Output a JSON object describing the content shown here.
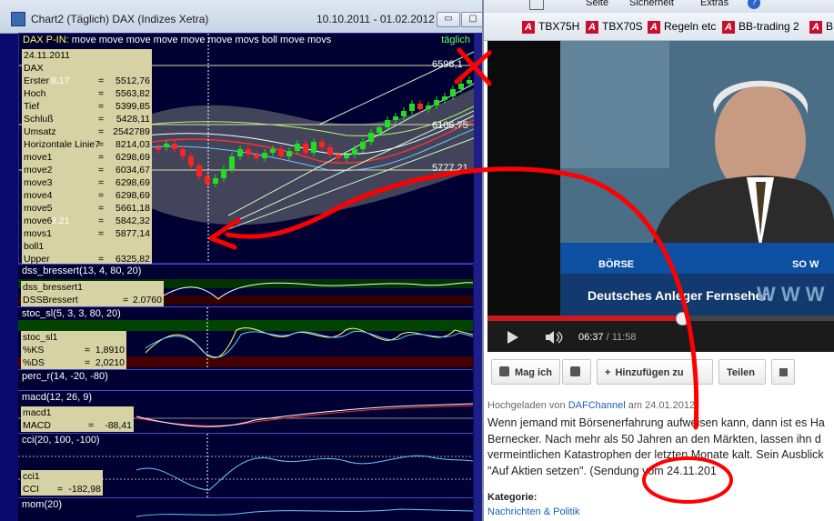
{
  "chart_window": {
    "title": "Chart2 (Täglich)  DAX (Indizes Xetra)",
    "date_range": "10.10.2011 - 01.02.2012",
    "minimize_label": "▭",
    "maximize_label": "▢"
  },
  "main_panel": {
    "headline_prefix": "DAX P-IN:",
    "headline_indicators": "move move move move move move movs boll move movs",
    "period_label": "täglich",
    "legend": [
      {
        "name": "24.11.2011",
        "value": ""
      },
      {
        "name": "DAX",
        "value": ""
      },
      {
        "name": "Erster",
        "value": "5512,76"
      },
      {
        "name": "Hoch",
        "value": "5563,82"
      },
      {
        "name": "Tief",
        "value": "5399,85"
      },
      {
        "name": "Schluß",
        "value": "5428,11"
      },
      {
        "name": "Umsatz",
        "value": "2542789"
      },
      {
        "name": "Horizontale Linie7",
        "value": "8214,03"
      },
      {
        "name": "move1",
        "value": "6298,69"
      },
      {
        "name": "move2",
        "value": "6034,67"
      },
      {
        "name": "move3",
        "value": "6298,69"
      },
      {
        "name": "move4",
        "value": "6298,69"
      },
      {
        "name": "move5",
        "value": "5661,18"
      },
      {
        "name": "move6",
        "value": "5842,32"
      },
      {
        "name": "movs1",
        "value": "5877,14"
      },
      {
        "name": "boll1",
        "value": ""
      },
      {
        "name": "Upper",
        "value": "6325,82"
      }
    ],
    "price_labels": [
      "6598,1",
      "6106,75",
      "5777,21"
    ],
    "side_labels": [
      "8,17",
      "3,21"
    ]
  },
  "indicators": {
    "dss": {
      "title": "dss_bressert(13, 4, 80, 20)",
      "legend_title": "dss_bressert1",
      "legend_name": "DSSBressert",
      "legend_value": "2.0760"
    },
    "stoc": {
      "title": "stoc_sl(5, 3, 3, 80, 20)",
      "legend_title": "stoc_sl1",
      "ks_name": "%KS",
      "ks_value": "1,8910",
      "ds_name": "%DS",
      "ds_value": "2,0210"
    },
    "perc": {
      "title": "perc_r(14, -20, -80)"
    },
    "macd": {
      "title": "macd(12, 26, 9)",
      "legend_title": "macd1",
      "legend_name": "MACD",
      "legend_value": "-88,41"
    },
    "cci": {
      "title": "cci(20, 100, -100)",
      "legend_title": "cci1",
      "legend_name": "CCI",
      "legend_value": "-182,98"
    },
    "mom": {
      "title": "mom(20)"
    }
  },
  "browser": {
    "menu": {
      "page": "Seite",
      "safety": "Sicherheit",
      "extras": "Extras",
      "help_icon": "?"
    },
    "favorites": [
      "TBX75H",
      "TBX70S",
      "Regeln etc",
      "BB-trading 2",
      "B"
    ],
    "video": {
      "banner_show": "BÖRSE",
      "banner_right": "SO W",
      "channel_line": "Deutsches Anleger Fernsehen",
      "watermark": "W W W",
      "current_time": "06:37",
      "duration": "11:58",
      "progress": 0.556
    },
    "actions": {
      "like": "Mag ich",
      "add": "Hinzufügen zu",
      "share": "Teilen"
    },
    "meta": {
      "prefix": "Hochgeladen von",
      "channel": "DAFChannel",
      "date_prefix": "am",
      "date": "24.01.2012"
    },
    "description": [
      "Wenn jemand mit Börsenerfahrung aufweisen kann, dann ist es Ha",
      "Bernecker. Nach mehr als 50 Jahren an den Märkten, lassen ihn d",
      "vermeintlichen Katastrophen der letzten Monate kalt. Sein Ausblick",
      "\"Auf Aktien setzen\". (Sendung vom 24.11.201"
    ],
    "category_label": "Kategorie:",
    "category": "Nachrichten & Politik"
  },
  "colors": {
    "chart_bg": "#000033",
    "up_candle": "#22dd22",
    "down_candle": "#ff2222",
    "annotation_red": "#ff0000",
    "youtube_red": "#cc181e",
    "link_blue": "#1a5fb4"
  }
}
